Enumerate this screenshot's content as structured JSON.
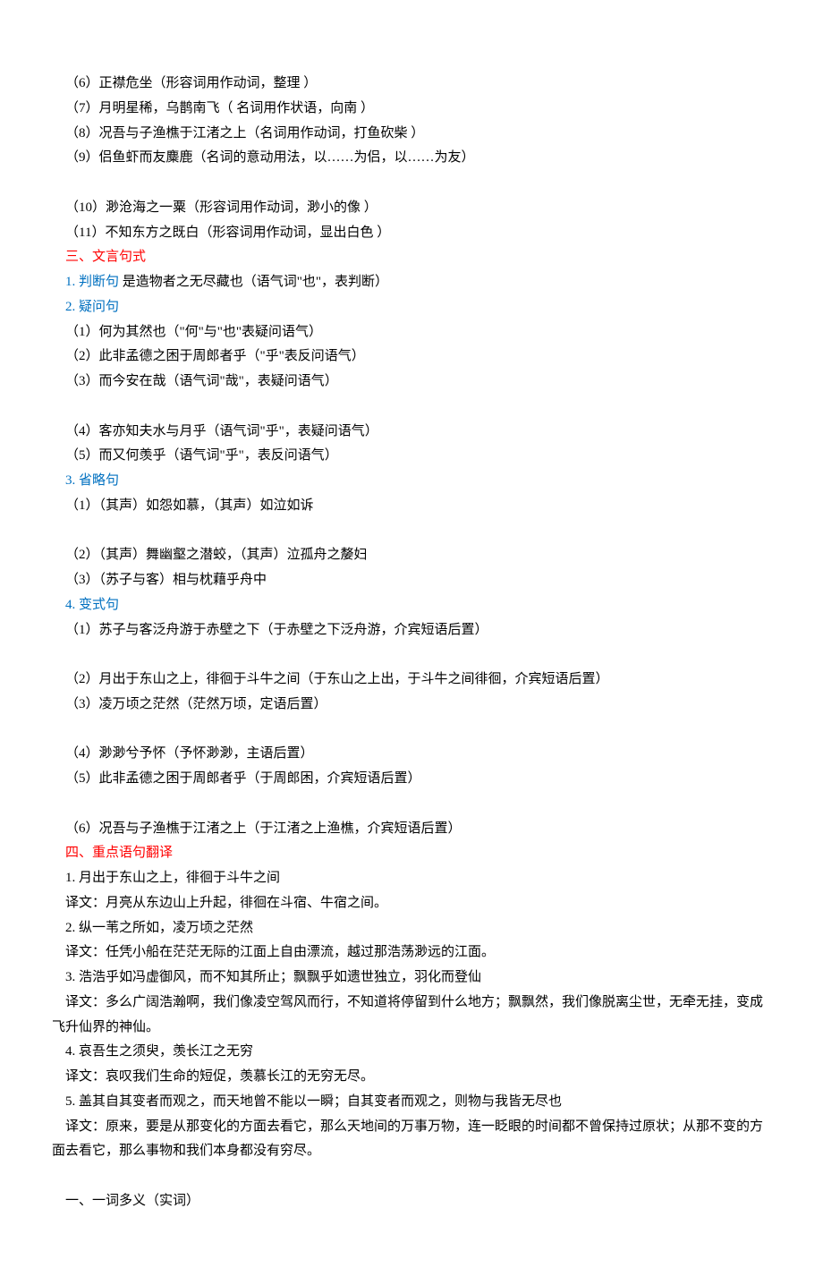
{
  "lines": [
    {
      "cls": "indent",
      "text": "（6）正襟危坐（形容词用作动词，整理 ）"
    },
    {
      "cls": "indent",
      "text": "（7）月明星稀，乌鹊南飞（ 名词用作状语，向南   ）"
    },
    {
      "cls": "indent",
      "text": "（8）况吾与子渔樵于江渚之上（名词用作动词，打鱼砍柴  ）"
    },
    {
      "cls": "indent",
      "text": "（9）侣鱼虾而友麋鹿（名词的意动用法，以……为侣，以……为友）"
    },
    {
      "cls": "indent",
      "text": "　"
    },
    {
      "cls": "indent",
      "text": "（10）渺沧海之一粟（形容词用作动词，渺小的像  ）"
    },
    {
      "cls": "indent",
      "text": "（11）不知东方之既白（形容词用作动词，显出白色  ）"
    },
    {
      "cls": "indent red",
      "text": "三、文言句式"
    },
    {
      "cls": "indent",
      "parts": [
        {
          "color": "blue",
          "text": "1. 判断句"
        },
        {
          "color": "",
          "text": "        是造物者之无尽藏也（语气词\"也\"，表判断）"
        }
      ]
    },
    {
      "cls": "indent blue",
      "text": "2. 疑问句"
    },
    {
      "cls": "indent",
      "text": "（1）何为其然也（\"何\"与\"也\"表疑问语气）"
    },
    {
      "cls": "indent",
      "text": "（2）此非孟德之困于周郎者乎（\"乎\"表反问语气）"
    },
    {
      "cls": "indent",
      "text": "（3）而今安在哉（语气词\"哉\"，表疑问语气）"
    },
    {
      "cls": "indent",
      "text": "　"
    },
    {
      "cls": "indent",
      "text": "（4）客亦知夫水与月乎（语气词\"乎\"，表疑问语气）"
    },
    {
      "cls": "indent",
      "text": "（5）而又何羡乎（语气词\"乎\"，表反问语气）"
    },
    {
      "cls": "indent blue",
      "text": "3. 省略句"
    },
    {
      "cls": "indent",
      "text": "（1）（其声）如怨如慕，（其声）如泣如诉"
    },
    {
      "cls": "indent",
      "text": "　"
    },
    {
      "cls": "indent",
      "text": "（2）（其声）舞幽壑之潜蛟，（其声）泣孤舟之嫠妇"
    },
    {
      "cls": "indent",
      "text": "（3）（苏子与客）相与枕藉乎舟中"
    },
    {
      "cls": "indent blue",
      "text": "4. 变式句"
    },
    {
      "cls": "indent",
      "text": "（1）苏子与客泛舟游于赤壁之下（于赤壁之下泛舟游，介宾短语后置）"
    },
    {
      "cls": "indent",
      "text": "　"
    },
    {
      "cls": "indent",
      "text": "（2）月出于东山之上，徘徊于斗牛之间（于东山之上出，于斗牛之间徘徊，介宾短语后置）"
    },
    {
      "cls": "indent",
      "text": "（3）凌万顷之茫然（茫然万顷，定语后置）"
    },
    {
      "cls": "indent",
      "text": "　"
    },
    {
      "cls": "indent",
      "text": "（4）渺渺兮予怀（予怀渺渺，主语后置）"
    },
    {
      "cls": "indent",
      "text": "（5）此非孟德之困于周郎者乎（于周郎困，介宾短语后置）"
    },
    {
      "cls": "indent",
      "text": "　"
    },
    {
      "cls": "indent",
      "text": "（6）况吾与子渔樵于江渚之上（于江渚之上渔樵，介宾短语后置）"
    },
    {
      "cls": "indent red",
      "text": "四、重点语句翻译"
    },
    {
      "cls": "indent",
      "text": "1. 月出于东山之上，徘徊于斗牛之间"
    },
    {
      "cls": "indent",
      "text": "译文：月亮从东边山上升起，徘徊在斗宿、牛宿之间。"
    },
    {
      "cls": "indent",
      "text": "2. 纵一苇之所如，凌万顷之茫然"
    },
    {
      "cls": "indent",
      "text": "译文：任凭小船在茫茫无际的江面上自由漂流，越过那浩荡渺远的江面。"
    },
    {
      "cls": "indent",
      "text": "3. 浩浩乎如冯虚御风，而不知其所止；飘飘乎如遗世独立，羽化而登仙"
    },
    {
      "cls": "indent",
      "text": "译文：多么广阔浩瀚啊，我们像凌空驾风而行，不知道将停留到什么地方；飘飘然，我们像脱离尘世，无牵无挂，变成飞升仙界的神仙。"
    },
    {
      "cls": "indent",
      "text": "4. 哀吾生之须臾，羡长江之无穷"
    },
    {
      "cls": "indent",
      "text": "译文：哀叹我们生命的短促，羡慕长江的无穷无尽。"
    },
    {
      "cls": "indent",
      "text": "5. 盖其自其变者而观之，而天地曾不能以一瞬；自其变者而观之，则物与我皆无尽也"
    },
    {
      "cls": "indent",
      "text": "译文：原来，要是从那变化的方面去看它，那么天地间的万事万物，连一眨眼的时间都不曾保持过原状；从那不变的方面去看它，那么事物和我们本身都没有穷尽。"
    },
    {
      "cls": "indent",
      "text": "　"
    },
    {
      "cls": "indent",
      "text": "一、一词多义（实词）"
    }
  ]
}
